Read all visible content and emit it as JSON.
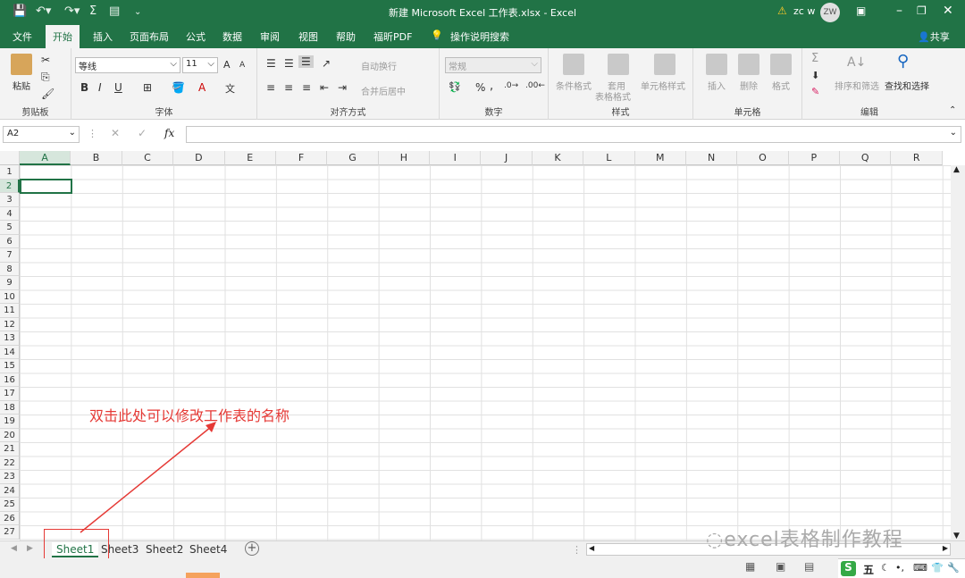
{
  "title": "新建 Microsoft Excel 工作表.xlsx - Excel",
  "user": {
    "name": "zc w",
    "initials": "ZW"
  },
  "share_label": "共享",
  "tabs": [
    "文件",
    "开始",
    "插入",
    "页面布局",
    "公式",
    "数据",
    "审阅",
    "视图",
    "帮助",
    "福昕PDF"
  ],
  "tellme": "操作说明搜索",
  "ribbon": {
    "clipboard": {
      "paste": "粘贴",
      "label": "剪贴板"
    },
    "font": {
      "name": "等线",
      "size": "11",
      "bold": "B",
      "italic": "I",
      "underline": "U",
      "grow": "A",
      "shrink": "A",
      "label": "字体"
    },
    "align": {
      "wrap": "自动换行",
      "merge": "合并后居中",
      "label": "对齐方式"
    },
    "number": {
      "format": "常规",
      "percent": "%",
      "comma": ",",
      "label": "数字"
    },
    "styles": {
      "cond": "条件格式",
      "table1": "套用",
      "table2": "表格格式",
      "cell": "单元格样式",
      "label": "样式"
    },
    "cells": {
      "insert": "插入",
      "delete": "删除",
      "format": "格式",
      "label": "单元格"
    },
    "editing": {
      "sort": "排序和筛选",
      "find": "查找和选择",
      "sigma": "Σ",
      "label": "编辑"
    }
  },
  "formula_bar": {
    "namebox": "A2",
    "fx": "fx",
    "value": ""
  },
  "columns": [
    "A",
    "B",
    "C",
    "D",
    "E",
    "F",
    "G",
    "H",
    "I",
    "J",
    "K",
    "L",
    "M",
    "N",
    "O",
    "P",
    "Q",
    "R"
  ],
  "rows": [
    "1",
    "2",
    "3",
    "4",
    "5",
    "6",
    "7",
    "8",
    "9",
    "10",
    "11",
    "12",
    "13",
    "14",
    "15",
    "16",
    "17",
    "18",
    "19",
    "20",
    "21",
    "22",
    "23",
    "24",
    "25",
    "26",
    "27"
  ],
  "sheets": [
    "Sheet1",
    "Sheet3",
    "Sheet2",
    "Sheet4"
  ],
  "annotation": "双击此处可以修改工作表的名称",
  "watermark": "excel表格制作教程",
  "ime": {
    "wubi": "五"
  },
  "colors": {
    "accent": "#217346",
    "annotation": "#e53935"
  }
}
